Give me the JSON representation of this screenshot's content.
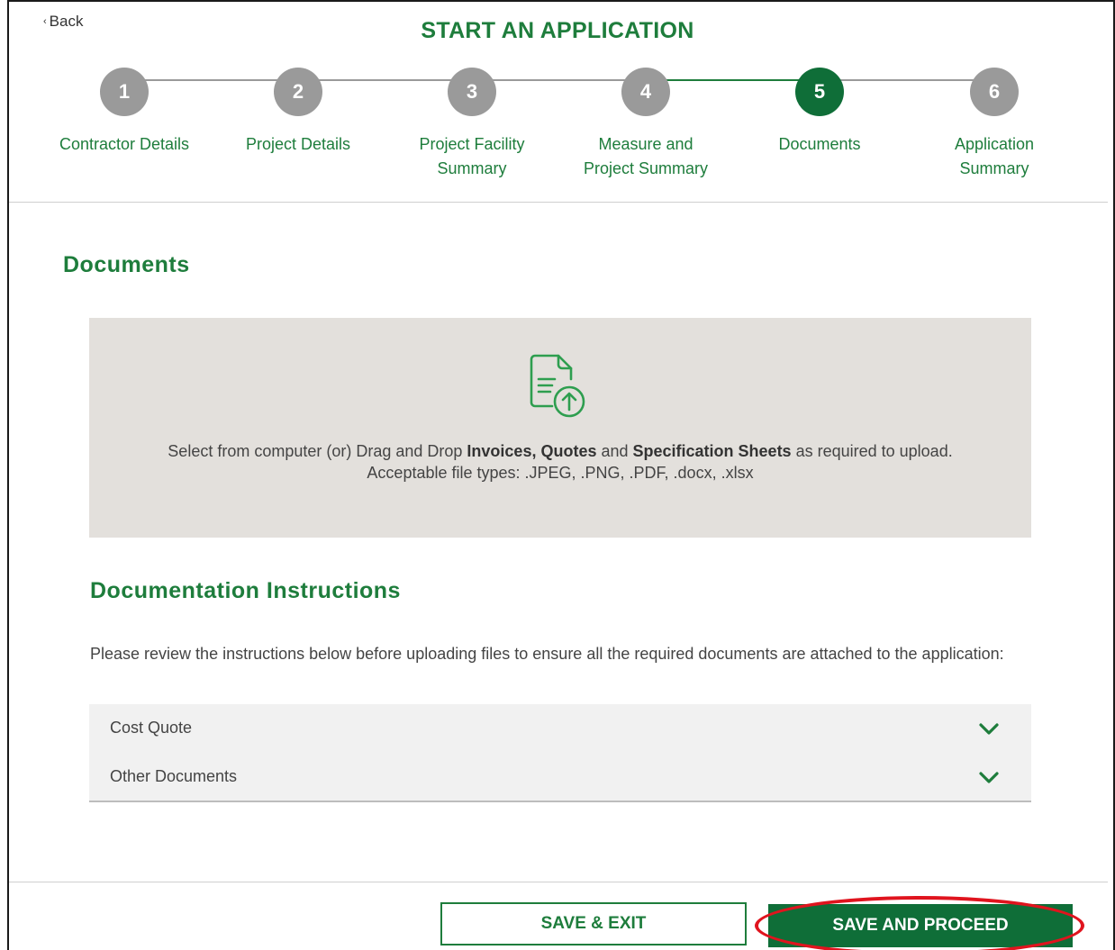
{
  "header": {
    "back_label": "Back",
    "title": "START AN APPLICATION"
  },
  "stepper": {
    "current_step": 5,
    "steps": [
      {
        "number": "1",
        "label": "Contractor Details"
      },
      {
        "number": "2",
        "label": "Project Details"
      },
      {
        "number": "3",
        "label": "Project Facility Summary"
      },
      {
        "number": "4",
        "label": "Measure and Project Summary"
      },
      {
        "number": "5",
        "label": "Documents"
      },
      {
        "number": "6",
        "label": "Application Summary"
      }
    ]
  },
  "documents": {
    "heading": "Documents",
    "dropzone": {
      "prefix": "Select from computer (or) Drag and Drop ",
      "bold1": "Invoices, Quotes",
      "mid": " and ",
      "bold2": "Specification Sheets",
      "suffix": " as required to upload.",
      "file_types": "Acceptable file types: .JPEG, .PNG, .PDF, .docx, .xlsx"
    }
  },
  "instructions": {
    "heading": "Documentation Instructions",
    "text": "Please review the instructions below before uploading files to ensure all the required documents are attached to the application:",
    "items": [
      {
        "label": "Cost Quote"
      },
      {
        "label": "Other Documents"
      }
    ]
  },
  "footer": {
    "save_exit_label": "SAVE & EXIT",
    "save_proceed_label": "SAVE AND PROCEED"
  },
  "colors": {
    "brand_green": "#1e7d3c",
    "active_step": "#0f6e38",
    "inactive_step": "#9a9a9a",
    "highlight": "#e0141e"
  },
  "icons": {
    "back": "chevron-left-icon",
    "upload": "document-upload-icon",
    "accordion": "chevron-down-icon"
  }
}
